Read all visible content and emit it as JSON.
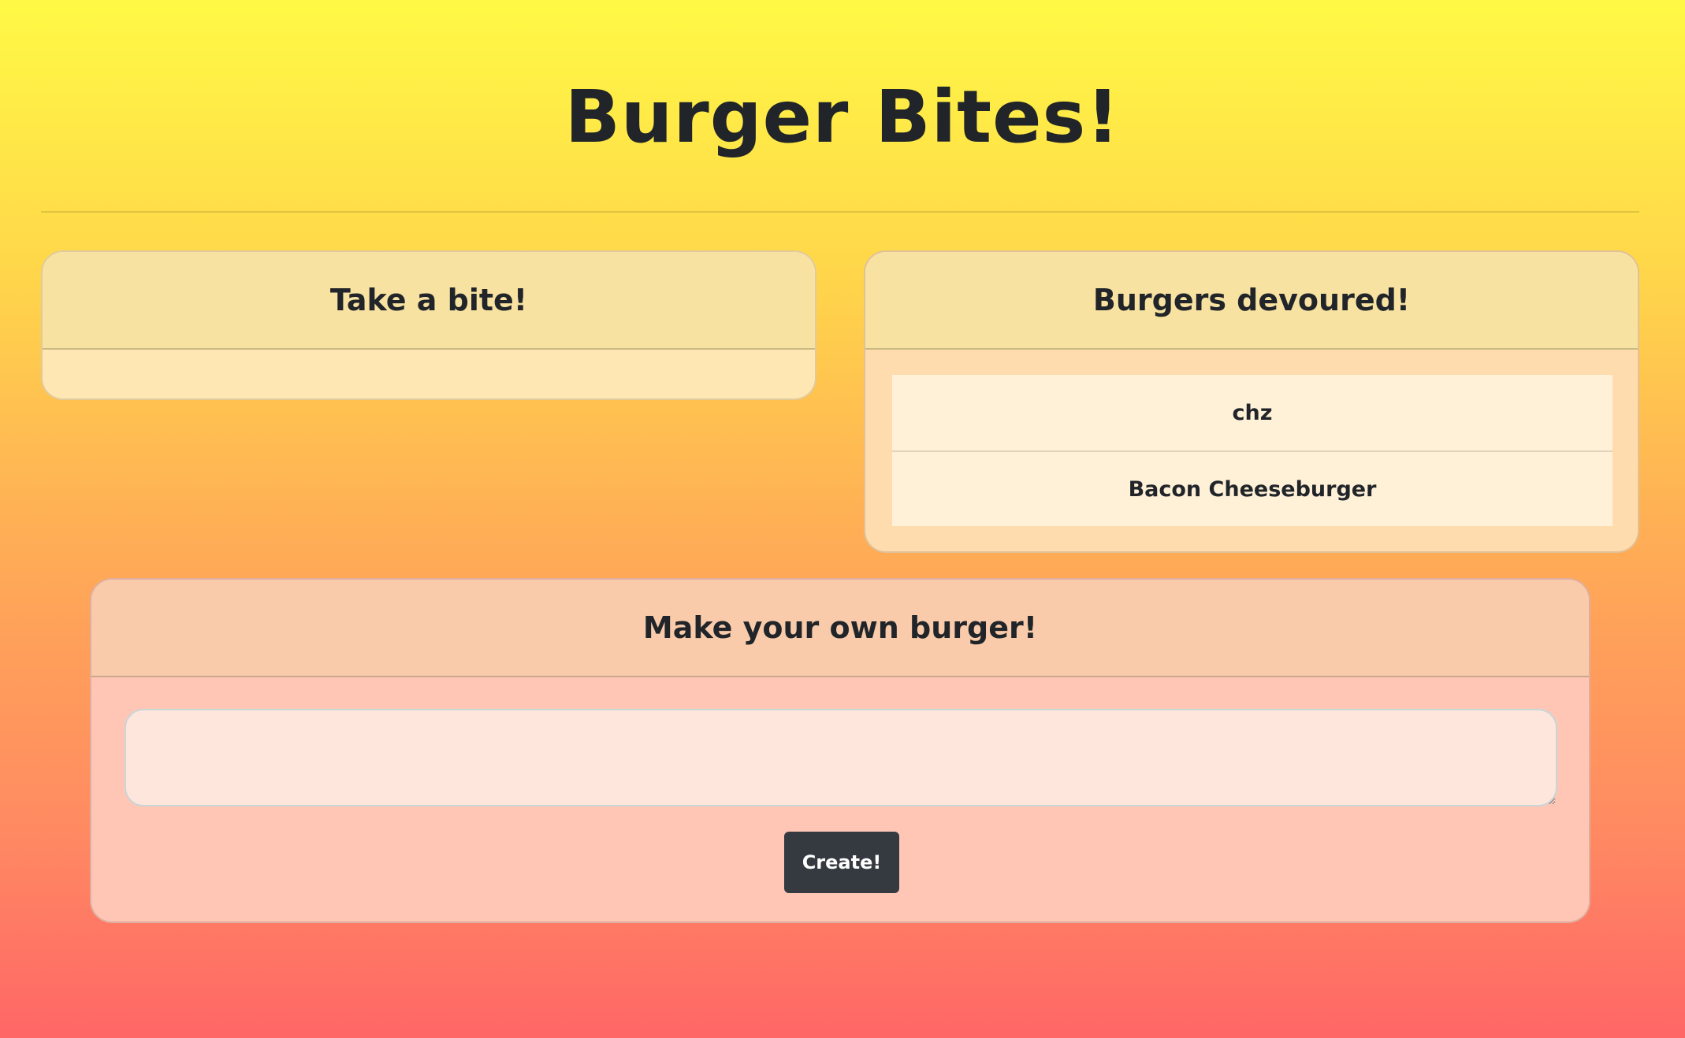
{
  "page": {
    "title": "Burger Bites!"
  },
  "take_bite": {
    "heading": "Take a bite!",
    "items": []
  },
  "devoured": {
    "heading": "Burgers devoured!",
    "items": [
      "chz",
      "Bacon Cheeseburger"
    ]
  },
  "make": {
    "heading": "Make your own burger!",
    "input_value": "",
    "button_label": "Create!"
  },
  "colors": {
    "button_bg": "#343a40",
    "text": "#212529",
    "gradient_top": "#fff945",
    "gradient_bottom": "#ff6666"
  }
}
